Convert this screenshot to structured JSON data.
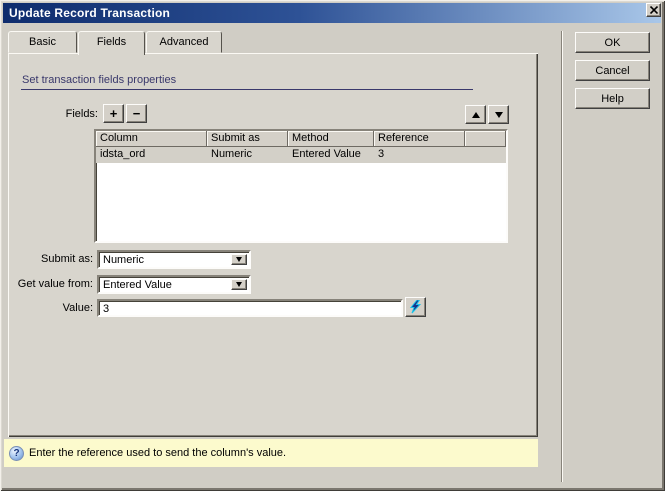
{
  "window": {
    "title": "Update Record Transaction"
  },
  "tabs": [
    {
      "label": "Basic"
    },
    {
      "label": "Fields"
    },
    {
      "label": "Advanced"
    }
  ],
  "panel": {
    "section_header": "Set transaction fields properties",
    "fields_label": "Fields:",
    "add_label": "+",
    "remove_label": "−"
  },
  "table": {
    "headers": [
      "Column",
      "Submit as",
      "Method",
      "Reference"
    ],
    "row": {
      "column": "idsta_ord",
      "submit_as": "Numeric",
      "method": "Entered Value",
      "reference": "3",
      "selected": true
    }
  },
  "form": {
    "submit_as_label": "Submit as:",
    "submit_as_value": "Numeric",
    "get_value_label": "Get value from:",
    "get_value_value": "Entered Value",
    "value_label": "Value:",
    "value_value": "3"
  },
  "action_buttons": {
    "ok": "OK",
    "cancel": "Cancel",
    "help": "Help"
  },
  "status_bar": {
    "icon_glyph": "?",
    "message": "Enter the reference used to send the column's value."
  },
  "colors": {
    "titlebar_left": "#0e2c6d",
    "titlebar_right": "#a9c7e9",
    "dialog_bg": "#d0cdc5",
    "panel_bg": "#d8d5cd",
    "section_header_text": "#39386b",
    "status_bg": "#fcfacd",
    "selected_row_bg": "#d3d0c8"
  }
}
